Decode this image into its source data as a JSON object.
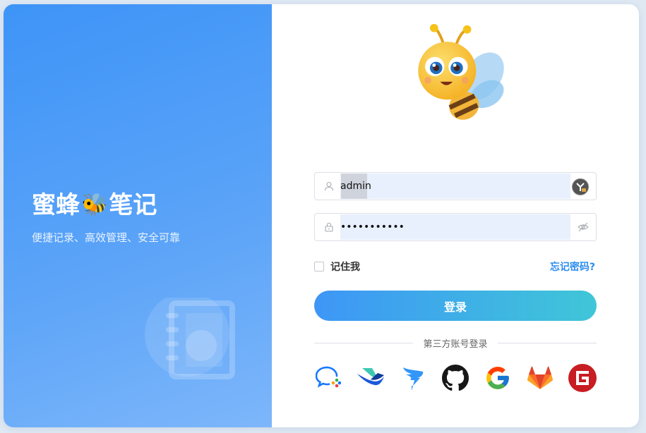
{
  "brand": {
    "title_part1": "蜜蜂",
    "bee_emoji": "🐝",
    "title_part2": "笔记",
    "tagline": "便捷记录、高效管理、安全可靠"
  },
  "login": {
    "username_value": "admin",
    "password_value": "•••••••••••",
    "remember_label": "记住我",
    "forgot_label": "忘记密码?",
    "submit_label": "登录",
    "third_party_label": "第三方账号登录"
  },
  "social_logins": [
    {
      "name": "WeChat Work",
      "icon": "wecom-icon"
    },
    {
      "name": "Feishu",
      "icon": "feishu-icon"
    },
    {
      "name": "DingTalk",
      "icon": "dingtalk-icon"
    },
    {
      "name": "GitHub",
      "icon": "github-icon"
    },
    {
      "name": "Google",
      "icon": "google-icon"
    },
    {
      "name": "GitLab",
      "icon": "gitlab-icon"
    },
    {
      "name": "Gitee",
      "icon": "gitee-icon"
    }
  ],
  "colors": {
    "primary": "#3e94f7",
    "link": "#2d8cf0",
    "button_gradient_end": "#3fc6d8"
  }
}
